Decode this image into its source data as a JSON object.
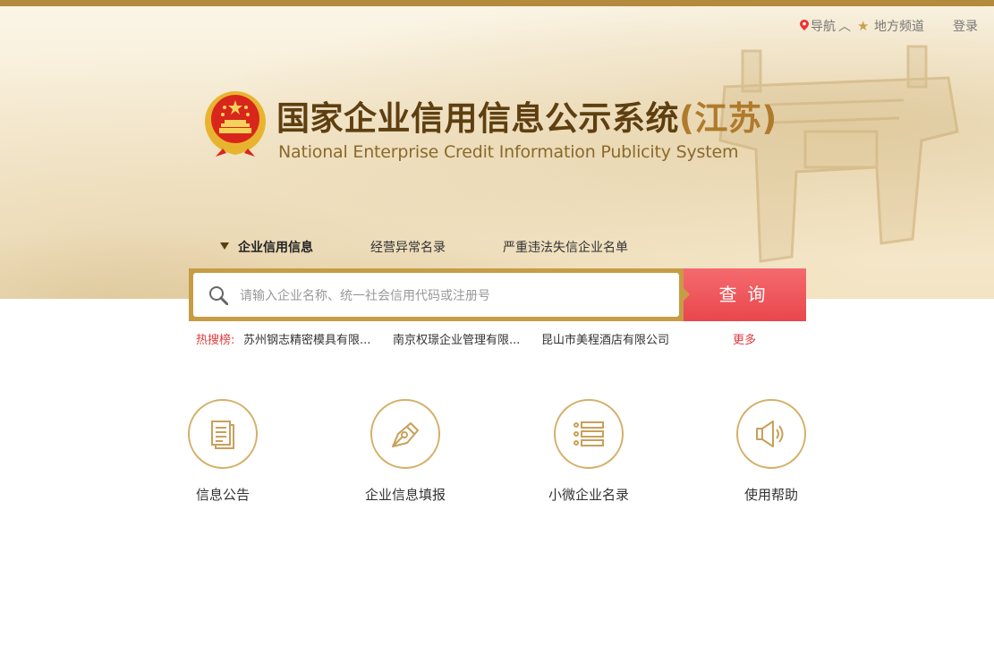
{
  "nav": {
    "guide": "导航",
    "local": "地方频道",
    "login": "登录"
  },
  "header": {
    "title_cn": "国家企业信用信息公示系统",
    "title_region": "(江苏)",
    "title_en": "National Enterprise Credit Information Publicity System"
  },
  "tabs": [
    {
      "label": "企业信用信息",
      "active": true
    },
    {
      "label": "经营异常名录",
      "active": false
    },
    {
      "label": "严重违法失信企业名单",
      "active": false
    }
  ],
  "search": {
    "placeholder": "请输入企业名称、统一社会信用代码或注册号",
    "button": "查询"
  },
  "hot": {
    "label": "热搜榜:",
    "items": [
      "苏州钢志精密模具有限...",
      "南京权璟企业管理有限...",
      "昆山市美程酒店有限公司"
    ],
    "more": "更多"
  },
  "features": [
    {
      "label": "信息公告",
      "icon": "document-icon"
    },
    {
      "label": "企业信息填报",
      "icon": "pen-nib-icon"
    },
    {
      "label": "小微企业名录",
      "icon": "list-icon"
    },
    {
      "label": "使用帮助",
      "icon": "speaker-icon"
    }
  ],
  "colors": {
    "accent_gold": "#c69d45",
    "button_red": "#e9474d",
    "title_brown": "#5e3f10",
    "hot_red": "#e23a3a"
  }
}
